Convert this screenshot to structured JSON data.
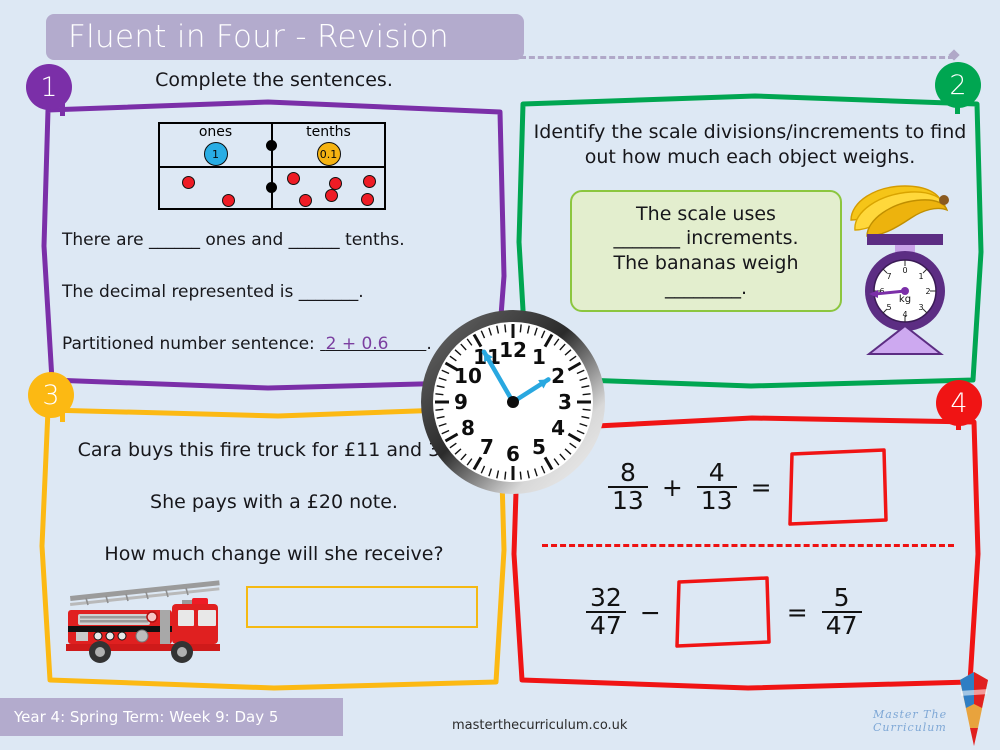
{
  "header": {
    "title": "Fluent in Four - Revision",
    "banner_color": "#b3abcd"
  },
  "questions": [
    {
      "number": "1",
      "accent_color": "#7b2fa8",
      "heading": "Complete the sentences.",
      "place_value_chart": {
        "columns": [
          "ones",
          "tenths"
        ],
        "chips": [
          "1",
          "0.1"
        ],
        "chip_colors": [
          "#29ade4",
          "#f5b312"
        ],
        "counts": [
          2,
          6
        ],
        "counter_color": "#ee1c25"
      },
      "sentence_1": "There are ______ ones and ______ tenths.",
      "sentence_2": "The decimal represented is _______.",
      "sentence_3_label": "Partitioned number sentence:",
      "sentence_3_answer": "2 + 0.6",
      "sentence_3_trail": "______.",
      "answer_ink_color": "#7b3fa0"
    },
    {
      "number": "2",
      "accent_color": "#00a651",
      "heading_line_1": "Identify the scale divisions/increments to find",
      "heading_line_2": "out how much each object weighs.",
      "prompt_box": {
        "line_1": "The scale uses",
        "line_2": "_______ increments.",
        "line_3": "The bananas weigh",
        "line_4": "________.",
        "fill_color": "#e3eece",
        "border_color": "#8cc63f"
      },
      "illustration": "banana-scale-image",
      "scale_dial": {
        "unit": "kg",
        "ticks": [
          "0",
          "1",
          "2",
          "3",
          "4",
          "5",
          "6",
          "7"
        ],
        "needle_points_to": "6"
      }
    },
    {
      "number": "3",
      "accent_color": "#fcb913",
      "line_1": "Cara buys this fire truck for £11 and 39p.",
      "line_2": "She pays with a £20 note.",
      "line_3": "How much change will she receive?",
      "illustration": "fire-truck-image",
      "answer_box_border": "#f5b912"
    },
    {
      "number": "4",
      "accent_color": "#f01414",
      "problem_1": {
        "fraction_a": {
          "numerator": "8",
          "denominator": "13"
        },
        "operator": "+",
        "fraction_b": {
          "numerator": "4",
          "denominator": "13"
        },
        "equals": "=",
        "answer": ""
      },
      "problem_2": {
        "fraction_a": {
          "numerator": "32",
          "denominator": "47"
        },
        "operator": "−",
        "answer": "",
        "equals": "=",
        "fraction_c": {
          "numerator": "5",
          "denominator": "47"
        }
      }
    }
  ],
  "clock": {
    "hour_numerals": [
      "12",
      "1",
      "2",
      "3",
      "4",
      "5",
      "6",
      "7",
      "8",
      "9",
      "10",
      "11"
    ],
    "hour_hand_points_to": "2",
    "minute_hand_points_to": "11",
    "time_shown": "1:55",
    "hand_color": "#29a8e0"
  },
  "footer": {
    "lesson_label": "Year 4: Spring Term: Week 9: Day 5",
    "website": "masterthecurriculum.co.uk",
    "brand": "Master The Curriculum"
  }
}
